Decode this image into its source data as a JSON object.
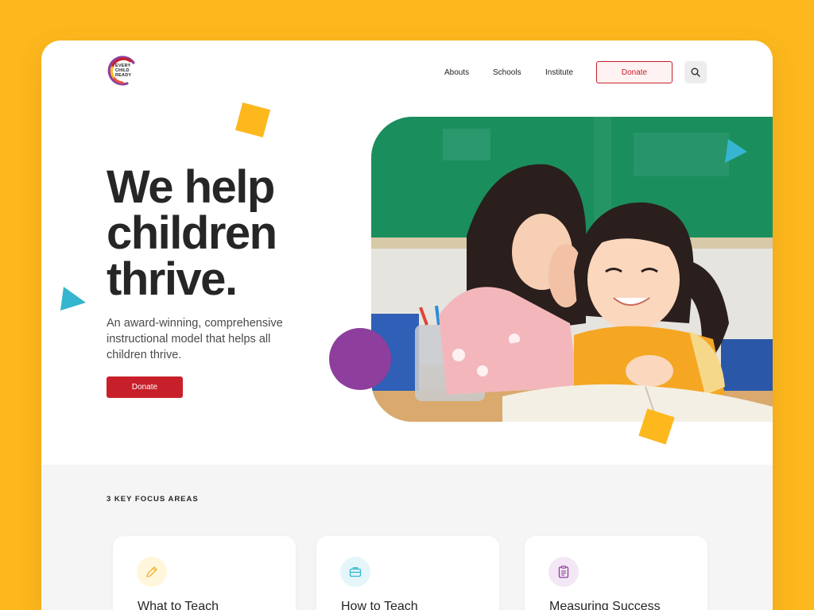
{
  "brand": {
    "logo_text": "EVERY CHILD READY",
    "logo_lines": [
      "EVERY",
      "CHILD",
      "READY"
    ]
  },
  "nav": {
    "items": [
      {
        "label": "Abouts"
      },
      {
        "label": "Schools"
      },
      {
        "label": "Institute"
      }
    ],
    "donate_label": "Donate",
    "search_icon": "search-icon"
  },
  "hero": {
    "headline_lines": [
      "We help",
      "children",
      "thrive."
    ],
    "subtext": "An award-winning, comprehensive instructional model that helps all children thrive.",
    "cta_label": "Donate",
    "image_icon": "photo-two-girls-laughing-classroom"
  },
  "focus": {
    "section_label": "3 KEY FOCUS AREAS",
    "cards": [
      {
        "title": "What to Teach",
        "icon": "pencil-icon",
        "icon_color": "#F2B531",
        "icon_bg": "#FFF6DC"
      },
      {
        "title": "How to Teach",
        "icon": "briefcase-icon",
        "icon_color": "#35B5CF",
        "icon_bg": "#E4F6FA"
      },
      {
        "title": "Measuring Success",
        "icon": "clipboard-icon",
        "icon_color": "#8E3E9C",
        "icon_bg": "#F3E7F5"
      }
    ]
  },
  "colors": {
    "background": "#FDB81E",
    "accent_red": "#C8202A",
    "yellow_shape": "#FDB81E",
    "teal_shape": "#35B5CF",
    "purple_shape": "#8E3E9C",
    "text_dark": "#262626"
  }
}
